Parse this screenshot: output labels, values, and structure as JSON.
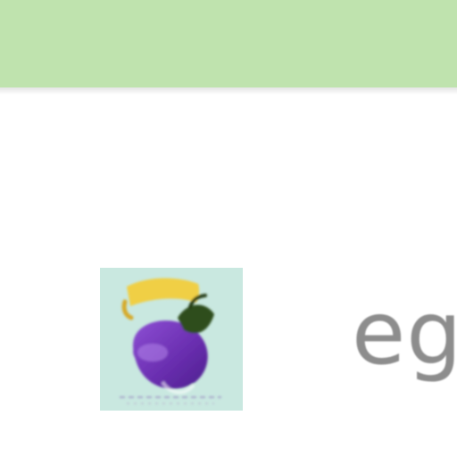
{
  "header": {
    "color": "#bfe3ae"
  },
  "list": {
    "items": [
      {
        "icon": "eggplant-icon",
        "label": "eg"
      }
    ]
  },
  "colors": {
    "thumb_background": "#c9e8e0",
    "eggplant": "#6b2fb1",
    "label_text": "#8d8d8d"
  }
}
